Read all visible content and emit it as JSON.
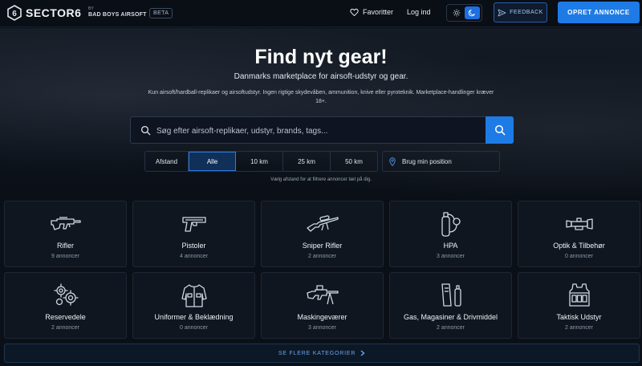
{
  "header": {
    "logo_text": "SECTOR6",
    "sub_brand_by": "BY",
    "sub_brand_name": "BAD BOYS AIRSOFT",
    "beta": "BETA",
    "favorites": "Favoritter",
    "login": "Log ind",
    "feedback": "FEEDBACK",
    "cta": "OPRET ANNONCE"
  },
  "hero": {
    "title": "Find nyt gear!",
    "subtitle": "Danmarks marketplace for airsoft-udstyr og gear.",
    "note": "Kun airsoft/hardball-replikaer og airsoftudstyr. Ingen rigtige skydevåben, ammunition, knive eller pyroteknik. Marketplace-handlinger kræver 18+.",
    "search_placeholder": "Søg efter airsoft-replikaer, udstyr, brands, tags...",
    "distance_label": "Afstand",
    "distance_options": [
      "Alle",
      "10 km",
      "25 km",
      "50 km"
    ],
    "distance_selected": "Alle",
    "use_position": "Brug min position",
    "hint": "Vælg afstand for at filtrere annoncer tæt på dig."
  },
  "categories": [
    {
      "label": "Rifler",
      "count": "9 annoncer",
      "icon": "rifle-icon"
    },
    {
      "label": "Pistoler",
      "count": "4 annoncer",
      "icon": "pistol-icon"
    },
    {
      "label": "Sniper Rifler",
      "count": "2 annoncer",
      "icon": "sniper-icon"
    },
    {
      "label": "HPA",
      "count": "3 annoncer",
      "icon": "hpa-tank-icon"
    },
    {
      "label": "Optik & Tilbehør",
      "count": "0 annoncer",
      "icon": "scope-icon"
    },
    {
      "label": "Reservedele",
      "count": "2 annoncer",
      "icon": "gears-icon"
    },
    {
      "label": "Uniformer & Beklædning",
      "count": "0 annoncer",
      "icon": "jacket-icon"
    },
    {
      "label": "Maskingeværer",
      "count": "3 annoncer",
      "icon": "machine-gun-icon"
    },
    {
      "label": "Gas, Magasiner & Drivmiddel",
      "count": "2 annoncer",
      "icon": "magazine-icon"
    },
    {
      "label": "Taktisk Udstyr",
      "count": "2 annoncer",
      "icon": "vest-icon"
    }
  ],
  "see_more": "SE FLERE KATEGORIER",
  "colors": {
    "accent": "#1e7be6",
    "background": "#0b1018",
    "card": "#0f161f"
  }
}
